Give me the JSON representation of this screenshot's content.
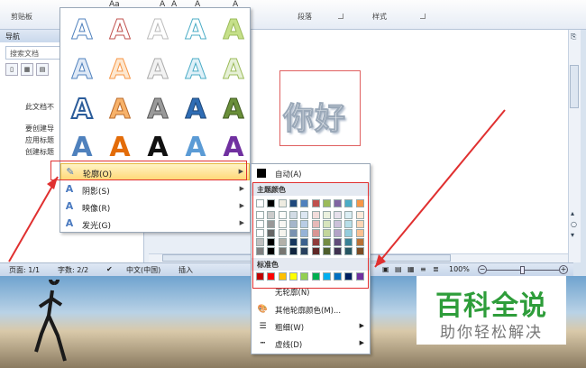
{
  "ribbon": {
    "groups": [
      "剪贴板",
      "段落",
      "样式"
    ],
    "buttons": [
      "A",
      "Aa",
      "A",
      "A",
      "A",
      "A"
    ]
  },
  "nav": {
    "title": "导航",
    "search_placeholder": "搜索文档",
    "tabs": [
      "▯",
      "▦",
      "▤"
    ],
    "lines": [
      "此文档不",
      "要创建导",
      "应用标题",
      "创建标题"
    ]
  },
  "document": {
    "text": "你好"
  },
  "gallery": {
    "items": [
      {
        "label": "轮廓(O)",
        "icon": "pen-icon"
      },
      {
        "label": "阴影(S)",
        "icon": "shadow-icon"
      },
      {
        "label": "映像(R)",
        "icon": "reflection-icon"
      },
      {
        "label": "发光(G)",
        "icon": "glow-icon"
      }
    ],
    "letter": "A"
  },
  "colors_submenu": {
    "auto_label": "自动(A)",
    "theme_header": "主题颜色",
    "standard_header": "标准色",
    "no_outline": "无轮廓(N)",
    "more_colors": "其他轮廓颜色(M)...",
    "weight": "粗细(W)",
    "dashes": "虚线(D)",
    "theme_top": [
      "#ffffff",
      "#000000",
      "#eeece1",
      "#1f497d",
      "#4f81bd",
      "#c0504d",
      "#9bbb59",
      "#8064a2",
      "#4bacc6",
      "#f79646"
    ],
    "standard": [
      "#c00000",
      "#ff0000",
      "#ffc000",
      "#ffff00",
      "#92d050",
      "#00b050",
      "#00b0f0",
      "#0070c0",
      "#002060",
      "#7030a0"
    ]
  },
  "status": {
    "page": "页面: 1/1",
    "words": "字数: 2/2",
    "language": "中文(中国)",
    "mode": "插入",
    "zoom": "100%"
  },
  "watermark": {
    "title": "百科全说",
    "subtitle": "助你轻松解决"
  }
}
